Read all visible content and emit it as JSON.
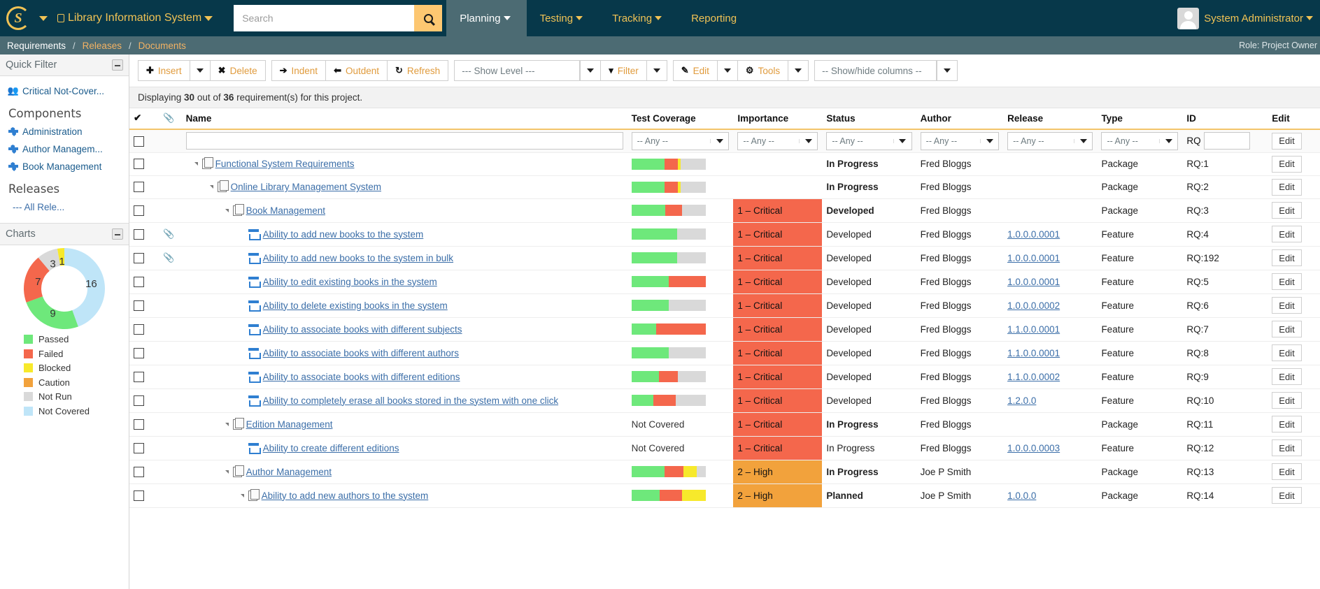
{
  "topbar": {
    "logo_letter": "S",
    "product_name": "Library Information System",
    "search": {
      "value": "",
      "placeholder": "Search"
    },
    "menu": [
      {
        "label": "Planning",
        "has_caret": true,
        "active": true
      },
      {
        "label": "Testing",
        "has_caret": true,
        "active": false
      },
      {
        "label": "Tracking",
        "has_caret": true,
        "active": false
      },
      {
        "label": "Reporting",
        "has_caret": false,
        "active": false
      }
    ],
    "user_name": "System Administrator"
  },
  "breadcrumb": {
    "items": [
      {
        "label": "Requirements",
        "current": true
      },
      {
        "label": "Releases",
        "current": false
      },
      {
        "label": "Documents",
        "current": false
      }
    ],
    "separator": "/",
    "role": "Role: Project Owner"
  },
  "sidebar": {
    "quick_filter": {
      "title": "Quick Filter",
      "items": [
        {
          "label": "Critical Not-Cover...",
          "icon": "people-icon"
        }
      ]
    },
    "components": {
      "title": "Components",
      "items": [
        {
          "label": "Administration",
          "icon": "puzzle-icon"
        },
        {
          "label": "Author Managem...",
          "icon": "puzzle-icon"
        },
        {
          "label": "Book Management",
          "icon": "puzzle-icon"
        }
      ]
    },
    "releases": {
      "title": "Releases",
      "items": [
        {
          "label": "--- All Rele..."
        }
      ]
    },
    "charts": {
      "title": "Charts"
    }
  },
  "chart_data": {
    "type": "pie",
    "title": "Charts",
    "subtitle": "Test coverage status breakdown",
    "donut": true,
    "labels": [
      "Passed",
      "Failed",
      "Blocked",
      "Caution",
      "Not Run",
      "Not Covered"
    ],
    "values": [
      9,
      7,
      1,
      0,
      3,
      16
    ],
    "visible_data_labels": [
      "16",
      "9",
      "7",
      "3"
    ],
    "colors": [
      "#6ee87b",
      "#f4674c",
      "#f7e92b",
      "#f2a23c",
      "#d9d9d9",
      "#bfe5f8"
    ],
    "legend_position": "bottom",
    "grid": false
  },
  "toolbar": {
    "insert_label": "Insert",
    "delete_label": "Delete",
    "indent_label": "Indent",
    "outdent_label": "Outdent",
    "refresh_label": "Refresh",
    "show_level_label": "--- Show Level ---",
    "filter_label": "Filter",
    "edit_label": "Edit",
    "tools_label": "Tools",
    "show_hide_columns_label": "-- Show/hide columns --"
  },
  "count_bar": {
    "prefix": "Displaying ",
    "shown": "30",
    "middle": " out of ",
    "total": "36",
    "suffix": " requirement(s) for this project."
  },
  "grid": {
    "columns": [
      "Name",
      "Test Coverage",
      "Importance",
      "Status",
      "Author",
      "Release",
      "Type",
      "ID",
      "Edit"
    ],
    "filter_row": {
      "name_value": "",
      "any_label": "-- Any --",
      "id_prefix": "RQ",
      "id_value": "",
      "edit_label": "Edit"
    },
    "edit_label": "Edit",
    "not_covered_label": "Not Covered",
    "rows": [
      {
        "indent": 0,
        "icon": "document-icon",
        "attachment": false,
        "expander": true,
        "name": "Functional System Requirements",
        "coverage": {
          "passed": 45,
          "failed": 18,
          "blocked": 3,
          "notrun": 34
        },
        "importance": "",
        "importance_color": "",
        "status": "In Progress",
        "status_bold": true,
        "author": "Fred Bloggs",
        "release": "",
        "type": "Package",
        "id": "RQ:1"
      },
      {
        "indent": 1,
        "icon": "document-icon",
        "attachment": false,
        "expander": true,
        "name": "Online Library Management System",
        "coverage": {
          "passed": 45,
          "failed": 18,
          "blocked": 3,
          "notrun": 34
        },
        "importance": "",
        "importance_color": "",
        "status": "In Progress",
        "status_bold": true,
        "author": "Fred Bloggs",
        "release": "",
        "type": "Package",
        "id": "RQ:2"
      },
      {
        "indent": 2,
        "icon": "document-icon",
        "attachment": false,
        "expander": true,
        "name": "Book Management",
        "coverage": {
          "passed": 46,
          "failed": 22,
          "blocked": 0,
          "notrun": 32
        },
        "importance": "1 – Critical",
        "importance_color": "#f4674c",
        "status": "Developed",
        "status_bold": true,
        "author": "Fred Bloggs",
        "release": "",
        "type": "Package",
        "id": "RQ:3"
      },
      {
        "indent": 3,
        "icon": "feature-icon",
        "attachment": true,
        "expander": false,
        "name": "Ability to add new books to the system",
        "coverage": {
          "passed": 62,
          "failed": 0,
          "blocked": 0,
          "notrun": 38
        },
        "importance": "1 – Critical",
        "importance_color": "#f4674c",
        "status": "Developed",
        "status_bold": false,
        "author": "Fred Bloggs",
        "release": "1.0.0.0.0001",
        "type": "Feature",
        "id": "RQ:4"
      },
      {
        "indent": 3,
        "icon": "feature-icon",
        "attachment": true,
        "expander": false,
        "name": "Ability to add new books to the system in bulk",
        "coverage": {
          "passed": 62,
          "failed": 0,
          "blocked": 0,
          "notrun": 38
        },
        "importance": "1 – Critical",
        "importance_color": "#f4674c",
        "status": "Developed",
        "status_bold": false,
        "author": "Fred Bloggs",
        "release": "1.0.0.0.0001",
        "type": "Feature",
        "id": "RQ:192"
      },
      {
        "indent": 3,
        "icon": "feature-icon",
        "attachment": false,
        "expander": false,
        "name": "Ability to edit existing books in the system",
        "coverage": {
          "passed": 50,
          "failed": 50,
          "blocked": 0,
          "notrun": 0
        },
        "importance": "1 – Critical",
        "importance_color": "#f4674c",
        "status": "Developed",
        "status_bold": false,
        "author": "Fred Bloggs",
        "release": "1.0.0.0.0001",
        "type": "Feature",
        "id": "RQ:5"
      },
      {
        "indent": 3,
        "icon": "feature-icon",
        "attachment": false,
        "expander": false,
        "name": "Ability to delete existing books in the system",
        "coverage": {
          "passed": 50,
          "failed": 0,
          "blocked": 0,
          "notrun": 50
        },
        "importance": "1 – Critical",
        "importance_color": "#f4674c",
        "status": "Developed",
        "status_bold": false,
        "author": "Fred Bloggs",
        "release": "1.0.0.0.0002",
        "type": "Feature",
        "id": "RQ:6"
      },
      {
        "indent": 3,
        "icon": "feature-icon",
        "attachment": false,
        "expander": false,
        "name": "Ability to associate books with different subjects",
        "coverage": {
          "passed": 33,
          "failed": 67,
          "blocked": 0,
          "notrun": 0
        },
        "importance": "1 – Critical",
        "importance_color": "#f4674c",
        "status": "Developed",
        "status_bold": false,
        "author": "Fred Bloggs",
        "release": "1.1.0.0.0001",
        "type": "Feature",
        "id": "RQ:7"
      },
      {
        "indent": 3,
        "icon": "feature-icon",
        "attachment": false,
        "expander": false,
        "name": "Ability to associate books with different authors",
        "coverage": {
          "passed": 50,
          "failed": 0,
          "blocked": 0,
          "notrun": 50
        },
        "importance": "1 – Critical",
        "importance_color": "#f4674c",
        "status": "Developed",
        "status_bold": false,
        "author": "Fred Bloggs",
        "release": "1.1.0.0.0001",
        "type": "Feature",
        "id": "RQ:8"
      },
      {
        "indent": 3,
        "icon": "feature-icon",
        "attachment": false,
        "expander": false,
        "name": "Ability to associate books with different editions",
        "coverage": {
          "passed": 37,
          "failed": 26,
          "blocked": 0,
          "notrun": 37
        },
        "importance": "1 – Critical",
        "importance_color": "#f4674c",
        "status": "Developed",
        "status_bold": false,
        "author": "Fred Bloggs",
        "release": "1.1.0.0.0002",
        "type": "Feature",
        "id": "RQ:9"
      },
      {
        "indent": 3,
        "icon": "feature-icon",
        "attachment": false,
        "expander": false,
        "name": "Ability to completely erase all books stored in the system with one click",
        "coverage": {
          "passed": 30,
          "failed": 30,
          "blocked": 0,
          "notrun": 40
        },
        "importance": "1 – Critical",
        "importance_color": "#f4674c",
        "status": "Developed",
        "status_bold": false,
        "author": "Fred Bloggs",
        "release": "1.2.0.0",
        "type": "Feature",
        "id": "RQ:10"
      },
      {
        "indent": 2,
        "icon": "document-icon",
        "attachment": false,
        "expander": true,
        "name": "Edition Management",
        "coverage": null,
        "coverage_text": "Not Covered",
        "importance": "1 – Critical",
        "importance_color": "#f4674c",
        "status": "In Progress",
        "status_bold": true,
        "author": "Fred Bloggs",
        "release": "",
        "type": "Package",
        "id": "RQ:11"
      },
      {
        "indent": 3,
        "icon": "feature-icon",
        "attachment": false,
        "expander": false,
        "name": "Ability to create different editions",
        "coverage": null,
        "coverage_text": "Not Covered",
        "importance": "1 – Critical",
        "importance_color": "#f4674c",
        "status": "In Progress",
        "status_bold": false,
        "author": "Fred Bloggs",
        "release": "1.0.0.0.0003",
        "type": "Feature",
        "id": "RQ:12"
      },
      {
        "indent": 2,
        "icon": "document-icon",
        "attachment": false,
        "expander": true,
        "name": "Author Management",
        "coverage": {
          "passed": 45,
          "failed": 25,
          "blocked": 18,
          "notrun": 12
        },
        "importance": "2 – High",
        "importance_color": "#f2a23c",
        "status": "In Progress",
        "status_bold": true,
        "author": "Joe P Smith",
        "release": "",
        "type": "Package",
        "id": "RQ:13"
      },
      {
        "indent": 3,
        "icon": "document-icon",
        "attachment": false,
        "expander": true,
        "name": "Ability to add new authors to the system",
        "coverage": {
          "passed": 38,
          "failed": 30,
          "blocked": 32,
          "notrun": 0
        },
        "importance": "2 – High",
        "importance_color": "#f2a23c",
        "status": "Planned",
        "status_bold": true,
        "author": "Joe P Smith",
        "release": "1.0.0.0",
        "type": "Package",
        "id": "RQ:14"
      }
    ]
  }
}
